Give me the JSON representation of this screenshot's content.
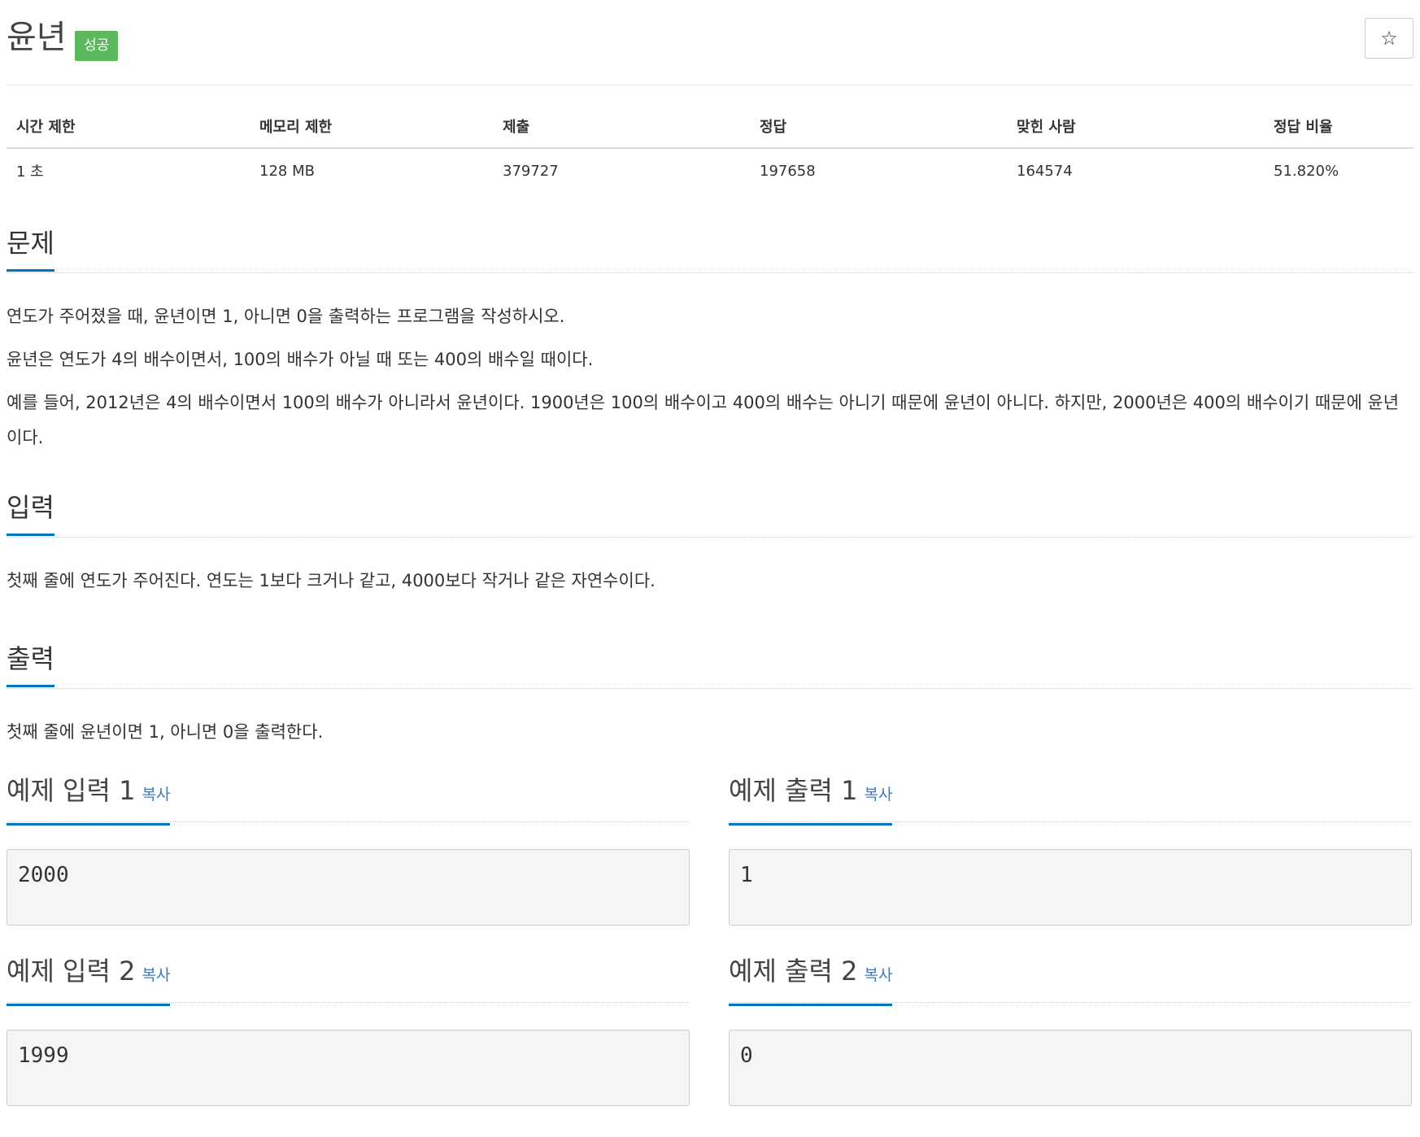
{
  "problem": {
    "title": "윤년",
    "status_badge": "성공",
    "star_icon": "☆"
  },
  "info_table": {
    "headers": [
      "시간 제한",
      "메모리 제한",
      "제출",
      "정답",
      "맞힌 사람",
      "정답 비율"
    ],
    "values": [
      "1 초",
      "128 MB",
      "379727",
      "197658",
      "164574",
      "51.820%"
    ]
  },
  "sections": {
    "description": {
      "heading": "문제",
      "paragraphs": [
        "연도가 주어졌을 때, 윤년이면 1, 아니면 0을 출력하는 프로그램을 작성하시오.",
        "윤년은 연도가 4의 배수이면서, 100의 배수가 아닐 때 또는 400의 배수일 때이다.",
        "예를 들어, 2012년은 4의 배수이면서 100의 배수가 아니라서 윤년이다. 1900년은 100의 배수이고 400의 배수는 아니기 때문에 윤년이 아니다. 하지만, 2000년은 400의 배수이기 때문에 윤년이다."
      ]
    },
    "input": {
      "heading": "입력",
      "text": "첫째 줄에 연도가 주어진다. 연도는 1보다 크거나 같고, 4000보다 작거나 같은 자연수이다."
    },
    "output": {
      "heading": "출력",
      "text": "첫째 줄에 윤년이면 1, 아니면 0을 출력한다."
    }
  },
  "samples": {
    "copy_label": "복사",
    "input1": {
      "heading": "예제 입력 1",
      "value": "2000"
    },
    "output1": {
      "heading": "예제 출력 1",
      "value": "1"
    },
    "input2": {
      "heading": "예제 입력 2",
      "value": "1999"
    },
    "output2": {
      "heading": "예제 출력 2",
      "value": "0"
    }
  },
  "colors": {
    "accent": "#0076c0",
    "success": "#5cb85c",
    "link": "#3b7bbf"
  }
}
